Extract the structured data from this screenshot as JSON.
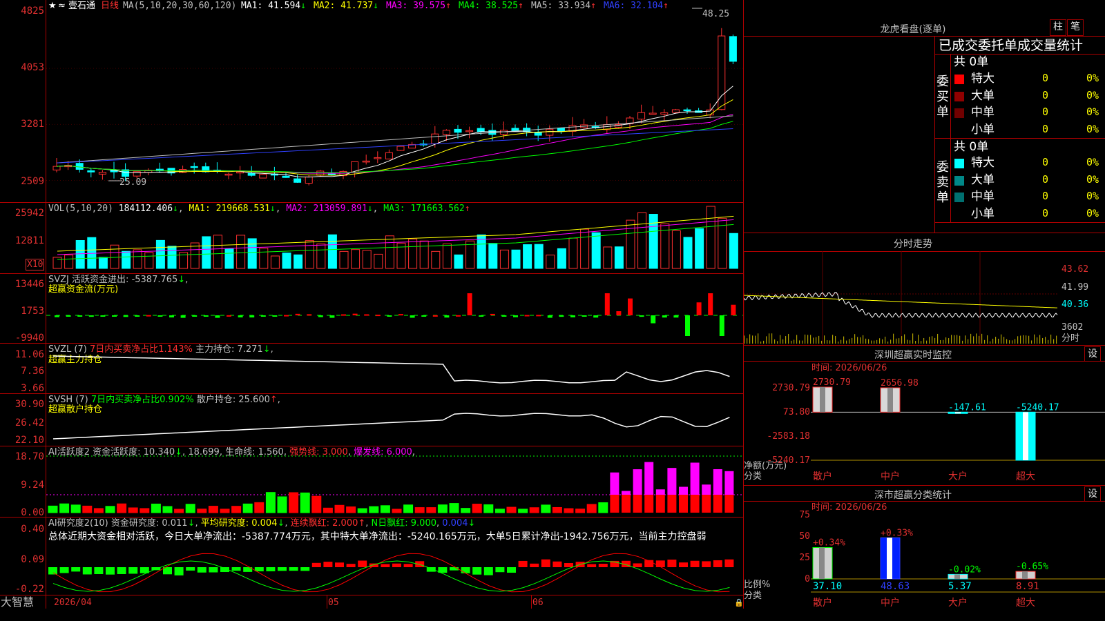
{
  "colors": {
    "up": "#ff3030",
    "down": "#00ffff",
    "grid": "#b00000",
    "ma1": "#ffffff",
    "ma2": "#ffff00",
    "ma3": "#ff00ff",
    "ma4": "#00ff00",
    "ma5": "#c0c0c0",
    "ma6": "#3040ff",
    "green": "#00ff00",
    "yellow": "#ffff00",
    "magenta": "#ff00ff",
    "red": "#ff0000"
  },
  "main": {
    "stock_name": "壹石通",
    "period": "日线",
    "ma_label": "MA(5,10,20,30,60,120)",
    "ma1": "MA1: 41.594",
    "ma2": "MA2: 41.737",
    "ma3": "MA3: 39.575",
    "ma4": "MA4: 38.525",
    "ma5": "MA5: 33.934",
    "ma6": "MA6: 32.104",
    "arrows": {
      "ma1": "↓",
      "ma2": "↓",
      "ma3": "↑",
      "ma4": "↑",
      "ma5": "↑",
      "ma6": "↑"
    },
    "high_mark": "48.25",
    "low_mark": "25.09",
    "y_ticks": [
      "4825",
      "4053",
      "3281",
      "2509"
    ]
  },
  "vol": {
    "label": "VOL(5,10,20)",
    "value": "184112.406",
    "ma1": "MA1: 219668.531",
    "ma2": "MA2: 213059.891",
    "ma3": "MA3: 171663.562",
    "y_ticks": [
      "25942",
      "12811"
    ],
    "unit": "X10"
  },
  "svzj": {
    "label": "SVZJ",
    "title": "活跃资金进出:",
    "value": "-5387.765",
    "sub": "超赢资金流(万元)",
    "y_ticks": [
      "13446",
      "1753",
      "-9940"
    ]
  },
  "svzl": {
    "label": "SVZL (7)",
    "ratio": "7日内买卖净占比1.143%",
    "hold": "主力持仓: 7.271",
    "sub": "超赢主力持仓",
    "y_ticks": [
      "11.06",
      "7.36",
      "3.66"
    ]
  },
  "svsh": {
    "label": "SVSH (7)",
    "ratio": "7日内买卖净占比0.902%",
    "hold": "散户持仓: 25.600",
    "sub": "超赢散户持仓",
    "y_ticks": [
      "30.90",
      "26.42",
      "22.10"
    ]
  },
  "ai1": {
    "label": "AI活跃度2",
    "active": "资金活跃度: 10.340",
    "v2": "18.699",
    "life": "生命线: 1.560",
    "strong": "强势线: 3.000",
    "boom": "爆发线: 6.000",
    "y_ticks": [
      "18.70",
      "9.24",
      "0.00"
    ]
  },
  "ai2": {
    "label": "AI研究度2(10)",
    "research": "资金研究度: 0.011",
    "avg": "平均研究度: 0.004",
    "cont": "连续飘红: 2.000",
    "nday": "N日飘红: 9.000",
    "last": "0.004",
    "summary": "总体近期大资金相对活跃，今日大单净流出：-5387.774万元，其中特大单净流出：-5240.165万元，大单5日累计净出-1942.756万元，当前主力控盘弱",
    "y_ticks": [
      "0.40",
      "0.09",
      "-0.22"
    ]
  },
  "xaxis": {
    "labels": [
      "2026/04",
      "05",
      "06"
    ]
  },
  "bottom_left": "大智慧",
  "dragon": {
    "title": "龙虎看盘(逐单)",
    "btn1": "柱",
    "btn2": "笔",
    "subtitle": "已成交委托单成交量统计",
    "buy": {
      "side": "委买单",
      "count": "共 0单",
      "rows": [
        {
          "name": "特大",
          "val": "0",
          "pct": "0%",
          "color": "#ff0000"
        },
        {
          "name": "大单",
          "val": "0",
          "pct": "0%",
          "color": "#900000"
        },
        {
          "name": "中单",
          "val": "0",
          "pct": "0%",
          "color": "#700000"
        },
        {
          "name": "小单",
          "val": "0",
          "pct": "0%",
          "color": ""
        }
      ]
    },
    "sell": {
      "side": "委卖单",
      "count": "共 0单",
      "rows": [
        {
          "name": "特大",
          "val": "0",
          "pct": "0%",
          "color": "#00ffff"
        },
        {
          "name": "大单",
          "val": "0",
          "pct": "0%",
          "color": "#008888"
        },
        {
          "name": "中单",
          "val": "0",
          "pct": "0%",
          "color": "#007070"
        },
        {
          "name": "小单",
          "val": "0",
          "pct": "0%",
          "color": ""
        }
      ]
    }
  },
  "intraday": {
    "title": "分时走势",
    "y_ticks": [
      "43.62",
      "41.99",
      "40.36"
    ],
    "vol_tick": "3602",
    "unit": "分时"
  },
  "monitor": {
    "title": "深圳超赢实时监控",
    "btn": "设",
    "time": "时间: 2026/06/26",
    "ylabel": "净额(万元)",
    "xlabel": "分类",
    "y_ticks": [
      "2730.79",
      "73.80",
      "-2583.18",
      "-5240.17"
    ],
    "chart_data": {
      "type": "bar",
      "categories": [
        "散户",
        "中户",
        "大户",
        "超大"
      ],
      "values": [
        2730.79,
        2656.98,
        -147.61,
        -5240.17
      ],
      "value_labels": [
        "2730.79",
        "2656.98",
        "-147.61",
        "-5240.17"
      ],
      "ylim": [
        -5240.17,
        2730.79
      ]
    }
  },
  "classify": {
    "title": "深市超赢分类统计",
    "btn": "设",
    "time": "时间: 2026/06/26",
    "ylabel": "比例%",
    "xlabel": "分类",
    "y_ticks": [
      "75",
      "50",
      "25",
      "0"
    ],
    "chart_data": {
      "type": "bar",
      "categories": [
        "散户",
        "中户",
        "大户",
        "超大"
      ],
      "values": [
        37.1,
        48.63,
        5.37,
        8.91
      ],
      "change_labels": [
        "+0.34%",
        "+0.33%",
        "-0.02%",
        "-0.65%"
      ],
      "value_labels": [
        "37.10",
        "48.63",
        "5.37",
        "8.91"
      ],
      "ylim": [
        0,
        75
      ]
    }
  }
}
